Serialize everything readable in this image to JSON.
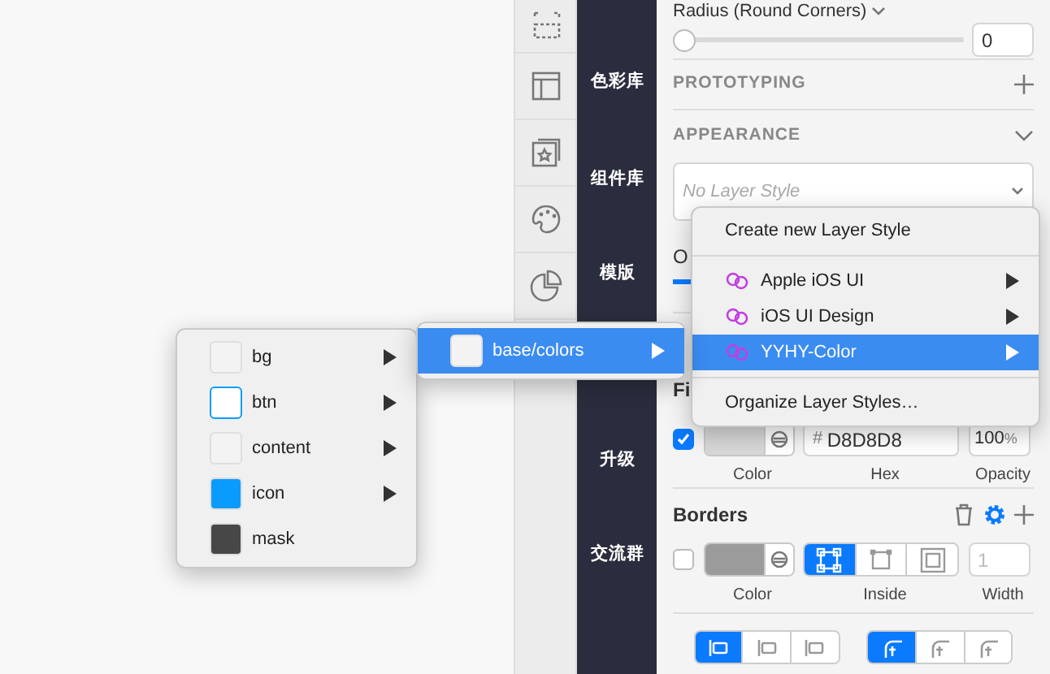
{
  "sidebar": {
    "items": [
      "色彩库",
      "组件库",
      "模版",
      "升级",
      "交流群"
    ]
  },
  "inspector": {
    "radius": {
      "label": "Radius (Round Corners)",
      "level": 0,
      "value": "0"
    },
    "prototyping": {
      "title": "PROTOTYPING"
    },
    "appearance": {
      "title": "APPEARANCE",
      "layer_style": {
        "placeholder": "No Layer Style"
      },
      "opacity": {
        "label": "O",
        "level": 1
      }
    },
    "fills": {
      "title": "Fi",
      "enabled": true,
      "hex_prefix": "#",
      "hex": "D8D8D8",
      "opacity": "100",
      "opacity_unit": "%",
      "labels": [
        "Color",
        "Hex",
        "Opacity"
      ]
    },
    "borders": {
      "title": "Borders",
      "enabled": false,
      "positions": [
        {
          "selected": true
        },
        {
          "selected": false
        },
        {
          "selected": false
        }
      ],
      "width_placeholder": "1",
      "labels": [
        "Color",
        "Inside",
        "Width"
      ]
    },
    "alignment_groups": [
      [
        {
          "selected": true
        },
        {
          "selected": false
        },
        {
          "selected": false
        }
      ],
      [
        {
          "selected": true
        },
        {
          "selected": false
        },
        {
          "selected": false
        }
      ]
    ]
  },
  "layer_style_menu": {
    "items": [
      {
        "kind": "action",
        "label": "Create new Layer Style"
      },
      {
        "kind": "separator"
      },
      {
        "kind": "library",
        "label": "Apple iOS UI",
        "selected": false
      },
      {
        "kind": "library",
        "label": "iOS UI Design",
        "selected": false
      },
      {
        "kind": "library",
        "label": "YYHY-Color",
        "selected": true
      },
      {
        "kind": "separator"
      },
      {
        "kind": "action",
        "label": "Organize Layer Styles…"
      }
    ]
  },
  "group_menu": {
    "items": [
      {
        "label": "base/colors",
        "color": "#f3f3f3",
        "selected": true,
        "submenu": true
      }
    ]
  },
  "color_menu": {
    "items": [
      {
        "label": "bg",
        "color": "#f3f3f3",
        "outlined": false,
        "submenu": true
      },
      {
        "label": "btn",
        "color": "#ffffff",
        "outlined": true,
        "submenu": true
      },
      {
        "label": "content",
        "color": "#f3f3f3",
        "outlined": false,
        "submenu": true
      },
      {
        "label": "icon",
        "color": "#0a9bff",
        "outlined": false,
        "submenu": true
      },
      {
        "label": "mask",
        "color": "#474747",
        "outlined": false,
        "submenu": false
      }
    ]
  }
}
